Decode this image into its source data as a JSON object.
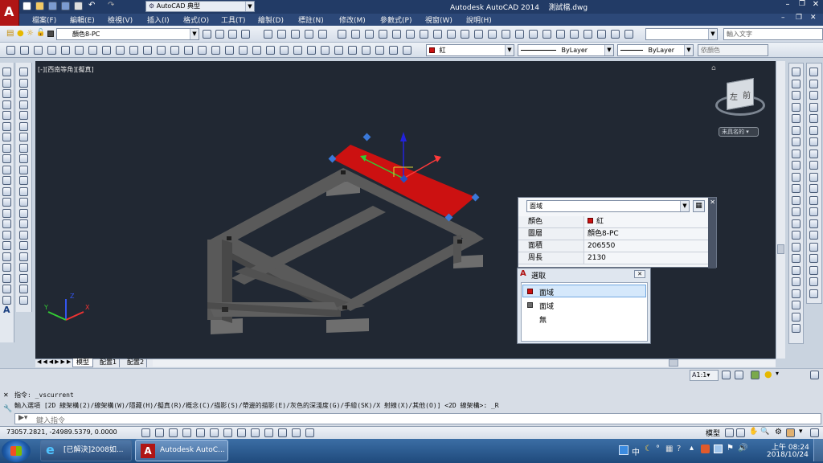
{
  "titlebar": {
    "workspace": "AutoCAD 典型",
    "title": "Autodesk AutoCAD 2014    測試檔.dwg"
  },
  "menubar": {
    "items": [
      "檔案(F)",
      "編輯(E)",
      "檢視(V)",
      "插入(I)",
      "格式(O)",
      "工具(T)",
      "繪製(D)",
      "標註(N)",
      "修改(M)",
      "參數式(P)",
      "視窗(W)",
      "說明(H)"
    ]
  },
  "toolbar": {
    "layer_value": "顏色8-PC",
    "search_placeholder": "輸入文字",
    "color_value": "紅",
    "linetype_value": "ByLayer",
    "lineweight_value": "ByLayer",
    "plotstyle_value": "依顏色"
  },
  "viewport": {
    "label": "[-][西南等角][擬真]",
    "viewcube_left": "左",
    "viewcube_front": "前",
    "unnamed_ucs": "未具名的",
    "axes": {
      "x": "X",
      "y": "Y",
      "z": "Z"
    }
  },
  "properties": {
    "object_type": "面域",
    "rows": [
      {
        "key": "顏色",
        "value": "紅",
        "swatch": "#cc1111"
      },
      {
        "key": "圖層",
        "value": "顏色8-PC"
      },
      {
        "key": "面積",
        "value": "206550"
      },
      {
        "key": "周長",
        "value": "2130"
      }
    ]
  },
  "selection_dialog": {
    "title": "選取",
    "items": [
      {
        "label": "面域",
        "swatch": "#cc1111",
        "selected": true
      },
      {
        "label": "面域",
        "swatch": "#6b6b6b",
        "selected": false
      },
      {
        "label": "無",
        "swatch": null,
        "selected": false
      }
    ]
  },
  "layout_tabs": [
    "模型",
    "配置1",
    "配置2"
  ],
  "status_right": {
    "scale": "1:1"
  },
  "command": {
    "line1": "指令: _vscurrent",
    "line2": "輸入選項 [2D 線架構(2)/線架構(W)/隱藏(H)/擬真(R)/概念(C)/描影(S)/帶邊的描影(E)/灰色的深淺度(G)/手繪(SK)/X 射線(X)/其他(O)] <2D 線架構>: _R",
    "input_placeholder": "鍵入指令"
  },
  "statusbar": {
    "coords": "73057.2821, -24989.5379, 0.0000",
    "model_label": "模型"
  },
  "taskbar": {
    "app1": "[已解決]2008如...",
    "app2": "Autodesk AutoC...",
    "ime": "中",
    "time": "上午 08:24",
    "date": "2018/10/24"
  },
  "colors": {
    "titlebar": "#223b66",
    "canvas": "#212833",
    "region": "#cc1111",
    "grip": "#3a78d8",
    "model_gray": "#5a5a5a"
  }
}
